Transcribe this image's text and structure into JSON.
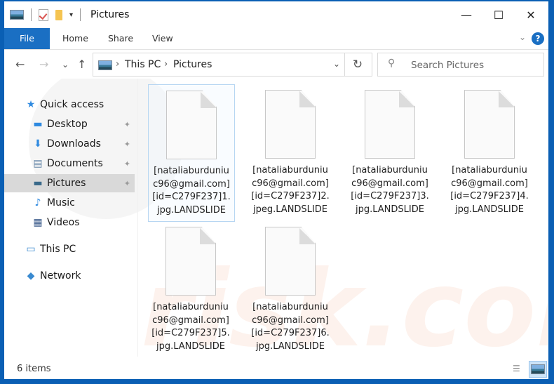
{
  "window": {
    "title": "Pictures",
    "controls": {
      "minimize": "—",
      "maximize": "☐",
      "close": "✕"
    }
  },
  "ribbon": {
    "tabs": [
      "File",
      "Home",
      "Share",
      "View"
    ],
    "help": "?",
    "expand": "⌄"
  },
  "address": {
    "back": "←",
    "forward": "→",
    "recent": "⌄",
    "up": "↑",
    "crumbs": [
      "This PC",
      "Pictures"
    ],
    "separator": "›",
    "dropdown": "⌄",
    "refresh": "↻"
  },
  "search": {
    "placeholder": "Search Pictures",
    "icon": "⚲"
  },
  "nav": {
    "items": [
      {
        "label": "Quick access",
        "icon": "star-icon",
        "glyph": "★"
      },
      {
        "label": "Desktop",
        "icon": "desktop-icon",
        "glyph": "▬",
        "pinned": true
      },
      {
        "label": "Downloads",
        "icon": "download-icon",
        "glyph": "⬇",
        "pinned": true
      },
      {
        "label": "Documents",
        "icon": "documents-icon",
        "glyph": "▤",
        "pinned": true
      },
      {
        "label": "Pictures",
        "icon": "pictures-icon",
        "glyph": "▬",
        "pinned": true,
        "selected": true
      },
      {
        "label": "Music",
        "icon": "music-icon",
        "glyph": "♪"
      },
      {
        "label": "Videos",
        "icon": "videos-icon",
        "glyph": "▦"
      },
      {
        "label": "This PC",
        "icon": "computer-icon",
        "glyph": "▭"
      },
      {
        "label": "Network",
        "icon": "network-icon",
        "glyph": "◆"
      }
    ],
    "pin_glyph": "📌"
  },
  "files": [
    {
      "name": "[nataliaburduniuc96@gmail.com][id=C279F237]1.jpg.LANDSLIDE",
      "selected": true
    },
    {
      "name": "[nataliaburduniuc96@gmail.com][id=C279F237]2.jpeg.LANDSLIDE"
    },
    {
      "name": "[nataliaburduniuc96@gmail.com][id=C279F237]3.jpg.LANDSLIDE"
    },
    {
      "name": "[nataliaburduniuc96@gmail.com][id=C279F237]4.jpg.LANDSLIDE"
    },
    {
      "name": "[nataliaburduniuc96@gmail.com][id=C279F237]5.jpg.LANDSLIDE"
    },
    {
      "name": "[nataliaburduniuc96@gmail.com][id=C279F237]6.jpg.LANDSLIDE"
    }
  ],
  "status": {
    "item_count": "6 items",
    "details_view": "☰"
  },
  "colors": {
    "accent": "#1a6fc3",
    "frame": "#0a5fb4",
    "selection": "#d9d9d9"
  }
}
